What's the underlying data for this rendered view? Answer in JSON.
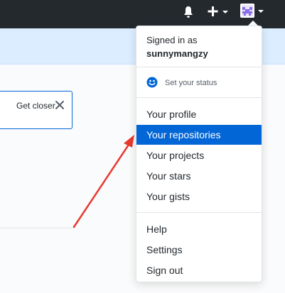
{
  "header": {
    "icons": {
      "notifications": "bell-icon",
      "create": "plus-icon",
      "create_caret": "caret-down-icon",
      "avatar": "user-avatar",
      "avatar_caret": "caret-down-icon"
    }
  },
  "notice": {
    "text": "Get closer",
    "close_icon": "close-icon"
  },
  "menu": {
    "signed_in_label": "Signed in as",
    "username": "sunnymangzy",
    "status": {
      "icon": "smiley-icon",
      "label": "Set your status"
    },
    "items_primary": [
      {
        "label": "Your profile"
      },
      {
        "label": "Your repositories",
        "active": true
      },
      {
        "label": "Your projects"
      },
      {
        "label": "Your stars"
      },
      {
        "label": "Your gists"
      }
    ],
    "items_secondary": [
      {
        "label": "Help"
      },
      {
        "label": "Settings"
      },
      {
        "label": "Sign out"
      }
    ]
  },
  "annotation": {
    "arrow_color": "#e8392f"
  },
  "colors": {
    "header_bg": "#24292e",
    "banner_bg": "#dbedff",
    "active_item_bg": "#0366d6",
    "page_bg": "#fafbfc"
  }
}
